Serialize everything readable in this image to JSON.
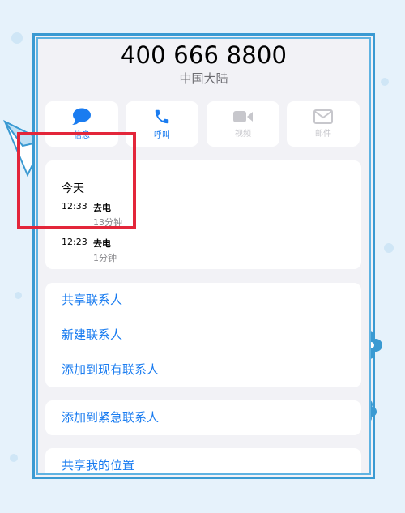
{
  "contact": {
    "number": "400 666 8800",
    "region": "中国大陆"
  },
  "actions": [
    {
      "label": "信息",
      "icon": "message-icon",
      "enabled": true
    },
    {
      "label": "呼叫",
      "icon": "phone-icon",
      "enabled": true
    },
    {
      "label": "视频",
      "icon": "video-icon",
      "enabled": false
    },
    {
      "label": "邮件",
      "icon": "mail-icon",
      "enabled": false
    }
  ],
  "recents": {
    "title": "今天",
    "calls": [
      {
        "time": "12:33",
        "type": "去电",
        "duration": "13分钟"
      },
      {
        "time": "12:23",
        "type": "去电",
        "duration": "1分钟"
      }
    ]
  },
  "menu_group1": [
    {
      "label": "共享联系人"
    },
    {
      "label": "新建联系人"
    },
    {
      "label": "添加到现有联系人"
    }
  ],
  "menu_group2": [
    {
      "label": "添加到紧急联系人"
    }
  ],
  "menu_group3": [
    {
      "label": "共享我的位置"
    }
  ],
  "colors": {
    "accent": "#1a7cf0",
    "highlight": "#e3263a",
    "frame": "#3a9ad2",
    "background": "#e6f2fb"
  }
}
